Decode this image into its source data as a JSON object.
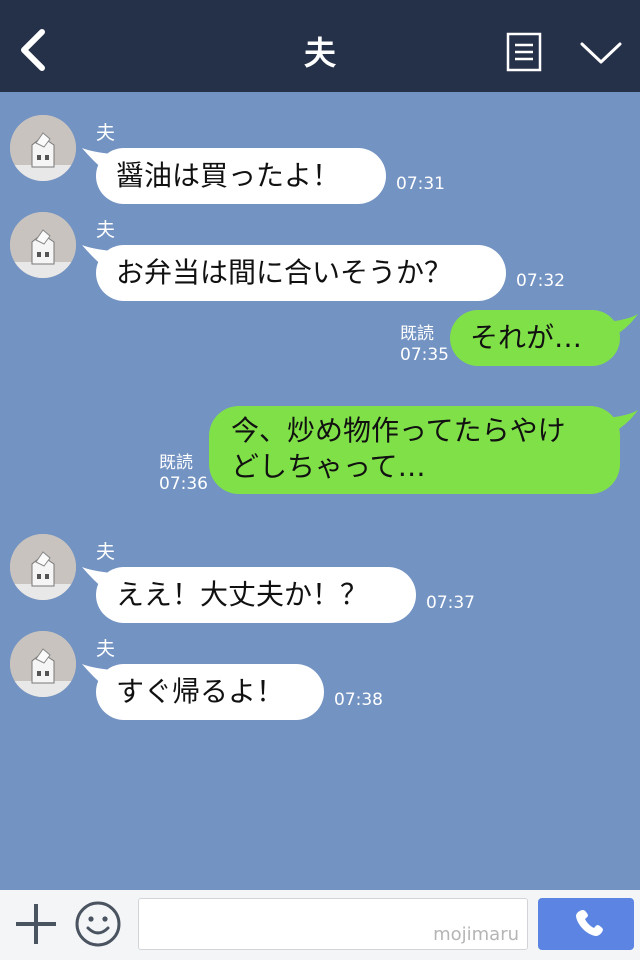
{
  "header": {
    "title": "夫"
  },
  "messages": [
    {
      "type": "in",
      "sender": "夫",
      "text": "醤油は買ったよ！",
      "time": "07:31"
    },
    {
      "type": "in",
      "sender": "夫",
      "text": "お弁当は間に合いそうか？",
      "time": "07:32"
    },
    {
      "type": "out",
      "read": "既読",
      "text": "それが…",
      "time": "07:35"
    },
    {
      "type": "out",
      "read": "既読",
      "lines": [
        "今、炒め物作ってたらやけ",
        "どしちゃって…"
      ],
      "time": "07:36"
    },
    {
      "type": "in",
      "sender": "夫",
      "text": "ええ！大丈夫か！？",
      "time": "07:37"
    },
    {
      "type": "in",
      "sender": "夫",
      "text": "すぐ帰るよ！",
      "time": "07:38"
    }
  ],
  "footer": {
    "input_watermark": "mojimaru"
  },
  "colors": {
    "header_bg": "#253049",
    "chat_bg": "#7393c3",
    "outgoing_bubble": "#80e048",
    "incoming_bubble": "#ffffff",
    "send_button": "#5c85e3"
  },
  "icons": {
    "back": "chevron-left-icon",
    "menu": "menu-list-icon",
    "collapse": "chevron-down-icon",
    "add": "plus-icon",
    "emoji": "smiley-icon",
    "send": "phone-icon"
  }
}
